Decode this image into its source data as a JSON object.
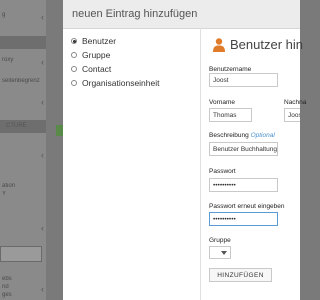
{
  "background": {
    "sidebar": {
      "rows": [
        {
          "text": "g"
        },
        {
          "text": ""
        },
        {
          "text": "roxy"
        },
        {
          "text": "seitenbegrenz"
        },
        {
          "text": ""
        },
        {
          "text": "ation"
        },
        {
          "text": "Y"
        },
        {
          "text": ""
        },
        {
          "text": "ebs"
        },
        {
          "text": "nd"
        },
        {
          "text": "ges"
        }
      ],
      "bar_label": "CTURE"
    }
  },
  "dialog": {
    "title": "neuen Eintrag hinzufügen",
    "types": [
      {
        "label": "Benutzer",
        "selected": true
      },
      {
        "label": "Gruppe",
        "selected": false
      },
      {
        "label": "Contact",
        "selected": false
      },
      {
        "label": "Organisationseinheit",
        "selected": false
      }
    ],
    "form": {
      "title": "Benutzer hin",
      "fields": {
        "username": {
          "label": "Benutzername",
          "value": "Joost"
        },
        "firstname": {
          "label": "Vorname",
          "value": "Thomas"
        },
        "lastname": {
          "label": "Nachna",
          "value": "Joos"
        },
        "description": {
          "label": "Beschreibung",
          "optional": "Optional",
          "value": "Benutzer Buchhaltung"
        },
        "password": {
          "label": "Passwort",
          "value": "••••••••••"
        },
        "password_repeat": {
          "label": "Passwort erneut eingeben",
          "value": "••••••••••"
        },
        "group": {
          "label": "Gruppe",
          "value": ""
        }
      },
      "submit_label": "HINZUFÜGEN"
    }
  },
  "colors": {
    "accent_icon": "#e07b2a",
    "optional_link": "#4a8fc9",
    "focus_border": "#5b9bd5"
  },
  "icons": [
    "chevron-right-icon",
    "user-icon",
    "select-arrow-icon"
  ]
}
